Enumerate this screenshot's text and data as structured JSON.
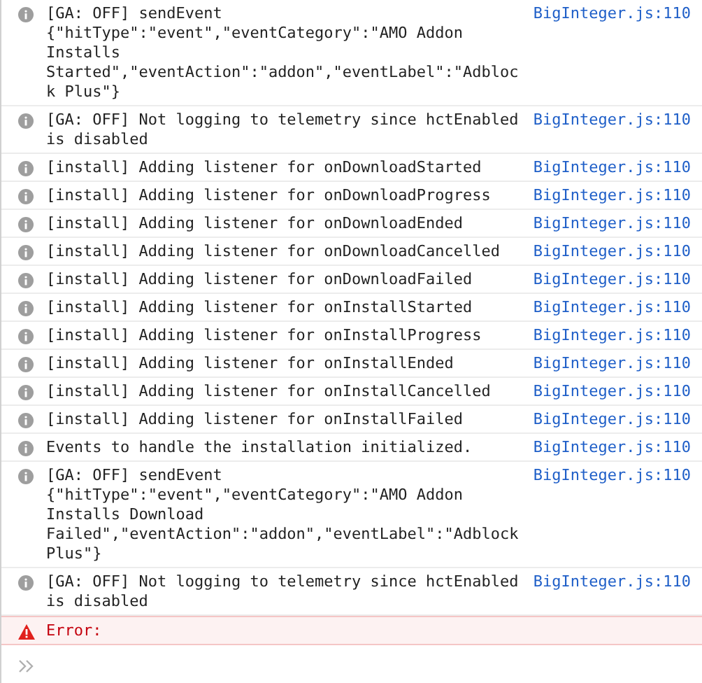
{
  "messages": [
    {
      "kind": "info",
      "text": "[GA: OFF] sendEvent {\"hitType\":\"event\",\"eventCategory\":\"AMO Addon Installs Started\",\"eventAction\":\"addon\",\"eventLabel\":\"Adblock Plus\"}",
      "source": "BigInteger.js:110"
    },
    {
      "kind": "info",
      "text": "[GA: OFF] Not logging to telemetry since hctEnabled is disabled",
      "source": "BigInteger.js:110"
    },
    {
      "kind": "info",
      "text": "[install] Adding listener for onDownloadStarted",
      "source": "BigInteger.js:110"
    },
    {
      "kind": "info",
      "text": "[install] Adding listener for onDownloadProgress",
      "source": "BigInteger.js:110"
    },
    {
      "kind": "info",
      "text": "[install] Adding listener for onDownloadEnded",
      "source": "BigInteger.js:110"
    },
    {
      "kind": "info",
      "text": "[install] Adding listener for onDownloadCancelled",
      "source": "BigInteger.js:110"
    },
    {
      "kind": "info",
      "text": "[install] Adding listener for onDownloadFailed",
      "source": "BigInteger.js:110"
    },
    {
      "kind": "info",
      "text": "[install] Adding listener for onInstallStarted",
      "source": "BigInteger.js:110"
    },
    {
      "kind": "info",
      "text": "[install] Adding listener for onInstallProgress",
      "source": "BigInteger.js:110"
    },
    {
      "kind": "info",
      "text": "[install] Adding listener for onInstallEnded",
      "source": "BigInteger.js:110"
    },
    {
      "kind": "info",
      "text": "[install] Adding listener for onInstallCancelled",
      "source": "BigInteger.js:110"
    },
    {
      "kind": "info",
      "text": "[install] Adding listener for onInstallFailed",
      "source": "BigInteger.js:110"
    },
    {
      "kind": "info",
      "text": "Events to handle the installation initialized.",
      "source": "BigInteger.js:110"
    },
    {
      "kind": "info",
      "text": "[GA: OFF] sendEvent {\"hitType\":\"event\",\"eventCategory\":\"AMO Addon Installs Download Failed\",\"eventAction\":\"addon\",\"eventLabel\":\"Adblock Plus\"}",
      "source": "BigInteger.js:110"
    },
    {
      "kind": "info",
      "text": "[GA: OFF] Not logging to telemetry since hctEnabled is disabled",
      "source": "BigInteger.js:110"
    },
    {
      "kind": "error",
      "text": "Error:"
    }
  ]
}
